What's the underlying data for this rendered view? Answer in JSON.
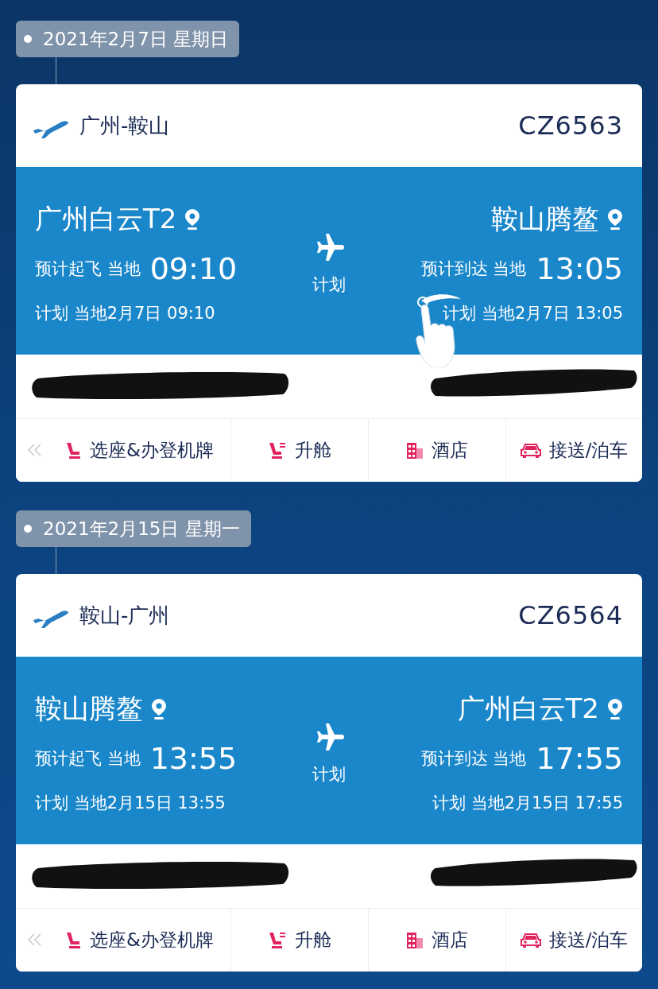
{
  "trips": [
    {
      "date": "2021年2月7日 星期日",
      "route": "广州-鞍山",
      "flight_no": "CZ6563",
      "departure": {
        "airport": "广州白云T2",
        "est_label": "预计起飞 当地",
        "est_time": "09:10",
        "plan": "计划 当地2月7日 09:10"
      },
      "status": "计划",
      "arrival": {
        "airport": "鞍山腾鳌",
        "est_label": "预计到达 当地",
        "est_time": "13:05",
        "plan": "计划 当地2月7日 13:05"
      },
      "swipe_hint": true,
      "actions": [
        {
          "kind": "seat",
          "label": "选座&办登机牌"
        },
        {
          "kind": "upgrade",
          "label": "升舱"
        },
        {
          "kind": "hotel",
          "label": "酒店"
        },
        {
          "kind": "car",
          "label": "接送/泊车"
        }
      ]
    },
    {
      "date": "2021年2月15日 星期一",
      "route": "鞍山-广州",
      "flight_no": "CZ6564",
      "departure": {
        "airport": "鞍山腾鳌",
        "est_label": "预计起飞 当地",
        "est_time": "13:55",
        "plan": "计划 当地2月15日 13:55"
      },
      "status": "计划",
      "arrival": {
        "airport": "广州白云T2",
        "est_label": "预计到达 当地",
        "est_time": "17:55",
        "plan": "计划 当地2月15日 17:55"
      },
      "swipe_hint": false,
      "actions": [
        {
          "kind": "seat",
          "label": "选座&办登机牌"
        },
        {
          "kind": "upgrade",
          "label": "升舱"
        },
        {
          "kind": "hotel",
          "label": "酒店"
        },
        {
          "kind": "car",
          "label": "接送/泊车"
        }
      ]
    }
  ]
}
